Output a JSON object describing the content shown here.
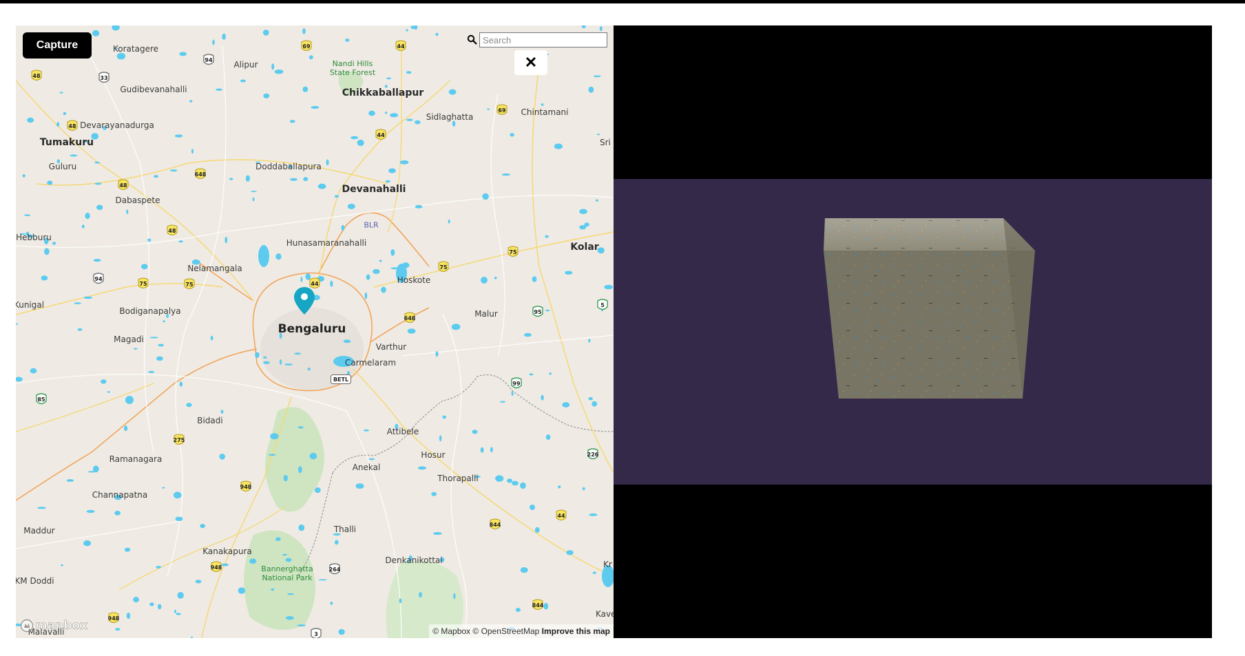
{
  "map": {
    "capture_label": "Capture",
    "search": {
      "placeholder": "Search",
      "value": ""
    },
    "close_label": "✕",
    "mapbox_logo": "mapbox",
    "attribution": {
      "mapbox": "© Mapbox",
      "osm": "© OpenStreetMap",
      "improve": "Improve this map"
    },
    "places": [
      {
        "name": "Koratagere",
        "size": "small"
      },
      {
        "name": "Alipur",
        "size": "small"
      },
      {
        "name": "Nandi Hills State Forest",
        "size": "park"
      },
      {
        "name": "Gudibevanahalli",
        "size": "small"
      },
      {
        "name": "Chikkaballapur",
        "size": "medium"
      },
      {
        "name": "Sidlaghatta",
        "size": "small"
      },
      {
        "name": "Chintamani",
        "size": "small"
      },
      {
        "name": "Devarayanadurga",
        "size": "small"
      },
      {
        "name": "Tumakuru",
        "size": "medium"
      },
      {
        "name": "Sri",
        "size": "small"
      },
      {
        "name": "Guluru",
        "size": "small"
      },
      {
        "name": "Doddaballapura",
        "size": "small"
      },
      {
        "name": "Devanahalli",
        "size": "medium"
      },
      {
        "name": "Dabaspete",
        "size": "small"
      },
      {
        "name": "BLR",
        "size": "airport"
      },
      {
        "name": "Hebburu",
        "size": "small"
      },
      {
        "name": "Hunasamaranahalli",
        "size": "small"
      },
      {
        "name": "Kolar",
        "size": "medium"
      },
      {
        "name": "Nelamangala",
        "size": "small"
      },
      {
        "name": "Hoskote",
        "size": "small"
      },
      {
        "name": "Kunigal",
        "size": "small"
      },
      {
        "name": "Bodiganapalya",
        "size": "small"
      },
      {
        "name": "Bengaluru",
        "size": "large"
      },
      {
        "name": "Malur",
        "size": "small"
      },
      {
        "name": "Magadi",
        "size": "small"
      },
      {
        "name": "Varthur",
        "size": "small"
      },
      {
        "name": "Carmelaram",
        "size": "small"
      },
      {
        "name": "Bidadi",
        "size": "small"
      },
      {
        "name": "Attibele",
        "size": "small"
      },
      {
        "name": "Ramanagara",
        "size": "small"
      },
      {
        "name": "Hosur",
        "size": "small"
      },
      {
        "name": "Anekal",
        "size": "small"
      },
      {
        "name": "Thorapalli",
        "size": "small"
      },
      {
        "name": "Channapatna",
        "size": "small"
      },
      {
        "name": "Maddur",
        "size": "small"
      },
      {
        "name": "Thalli",
        "size": "small"
      },
      {
        "name": "Kanakapura",
        "size": "small"
      },
      {
        "name": "Bannerghatta National Park",
        "size": "park"
      },
      {
        "name": "Denkanikottai",
        "size": "small"
      },
      {
        "name": "Kr",
        "size": "small"
      },
      {
        "name": "KM Doddi",
        "size": "small"
      },
      {
        "name": "Kave",
        "size": "small"
      },
      {
        "name": "Malavalli",
        "size": "small"
      }
    ],
    "road_shields": [
      "69",
      "44",
      "94",
      "48",
      "33",
      "44",
      "69",
      "48",
      "648",
      "48",
      "48",
      "75",
      "94",
      "75",
      "75",
      "44",
      "75",
      "5",
      "648",
      "95",
      "85",
      "99",
      "275",
      "226",
      "948",
      "844",
      "44",
      "948",
      "264",
      "844",
      "948",
      "3",
      "BETL"
    ]
  },
  "viewer": {
    "scene_color": "#342949",
    "object": "cube-with-map-texture"
  }
}
